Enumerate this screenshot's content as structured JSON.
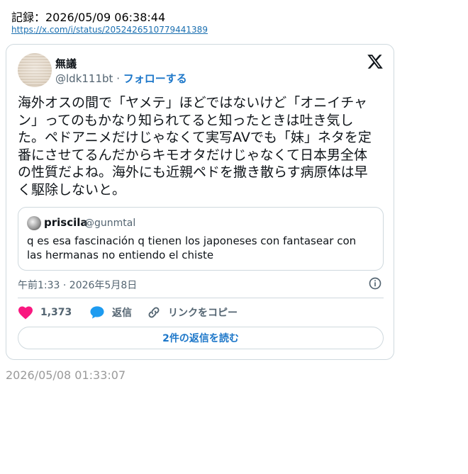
{
  "record": {
    "label": "記録：2026/05/09 06:38:44",
    "url": "https://x.com/i/status/2052426510779441389"
  },
  "tweet": {
    "author": {
      "display_name": "無議",
      "handle": "@ldk111bt",
      "separator": "·",
      "follow_label": "フォローする"
    },
    "text": "海外オスの間で「ヤメテ」ほどではないけど「オニイチャン」ってのもかなり知られてると知ったときは吐き気した。ペドアニメだけじゃなくて実写AVでも「妹」ネタを定番にさせてるんだからキモオタだけじゃなくて日本男全体の性質だよね。海外にも近親ペドを撒き散らす病原体は早く駆除しないと。",
    "quote": {
      "display_name": "priscila",
      "handle": "@gunmtal",
      "text": "q es esa fascinación q tienen los japoneses con fantasear con las hermanas no entiendo el chiste"
    },
    "timestamp": "午前1:33 · 2026年5月8日",
    "actions": {
      "like_count": "1,373",
      "reply_label": "返信",
      "copy_link_label": "リンクをコピー"
    },
    "read_replies_label": "2件の返信を読む"
  },
  "footer": {
    "date": "2026/05/08 01:33:07"
  },
  "colors": {
    "link": "#1d77c9",
    "like": "#f91880",
    "reply": "#1d9bf0",
    "muted": "#536471"
  },
  "icons": [
    "x-logo-icon",
    "info-icon",
    "heart-icon",
    "speech-bubble-icon",
    "link-icon"
  ]
}
